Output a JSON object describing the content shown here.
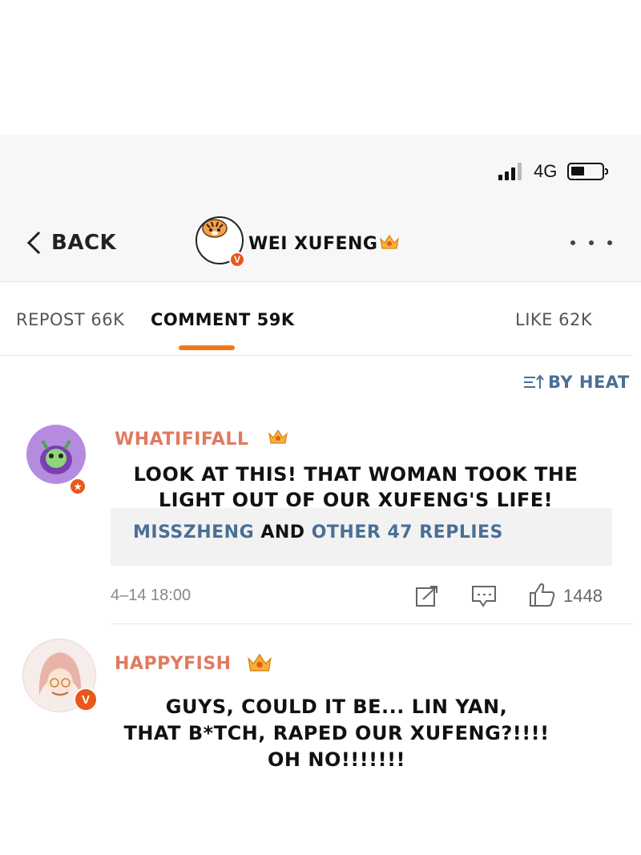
{
  "status_bar": {
    "network": "4G"
  },
  "nav": {
    "back_label": "BACK",
    "profile_name": "WEI XUFENG",
    "verified_badge": "V",
    "more_icon": "more-dots-icon"
  },
  "tabs": [
    {
      "label": "REPOST 66K",
      "active": false
    },
    {
      "label": "COMMENT 59K",
      "active": true
    },
    {
      "label": "LIKE 62K",
      "active": false
    }
  ],
  "sort_label": "BY HEAT",
  "colors": {
    "accent": "#f07a1a",
    "username": "#e07a5f",
    "link": "#4a6f96",
    "verified": "#e9581b"
  },
  "comments": [
    {
      "username": "WHATIFIFALL",
      "text_line1": "LOOK AT THIS! THAT WOMAN TOOK THE",
      "text_line2": "LIGHT OUT OF OUR XUFENG'S LIFE!",
      "replies": {
        "first_user": "MISSZHENG",
        "connector": "AND",
        "other": "OTHER 47 REPLIES"
      },
      "time": "4–14 18:00",
      "likes": "1448"
    },
    {
      "username": "HAPPYFISH",
      "verified_badge": "V",
      "text_line1": "GUYS, COULD IT BE... LIN YAN,",
      "text_line2": "THAT B*TCH, RAPED OUR XUFENG?!!!!",
      "text_line3": "OH NO!!!!!!!"
    }
  ]
}
